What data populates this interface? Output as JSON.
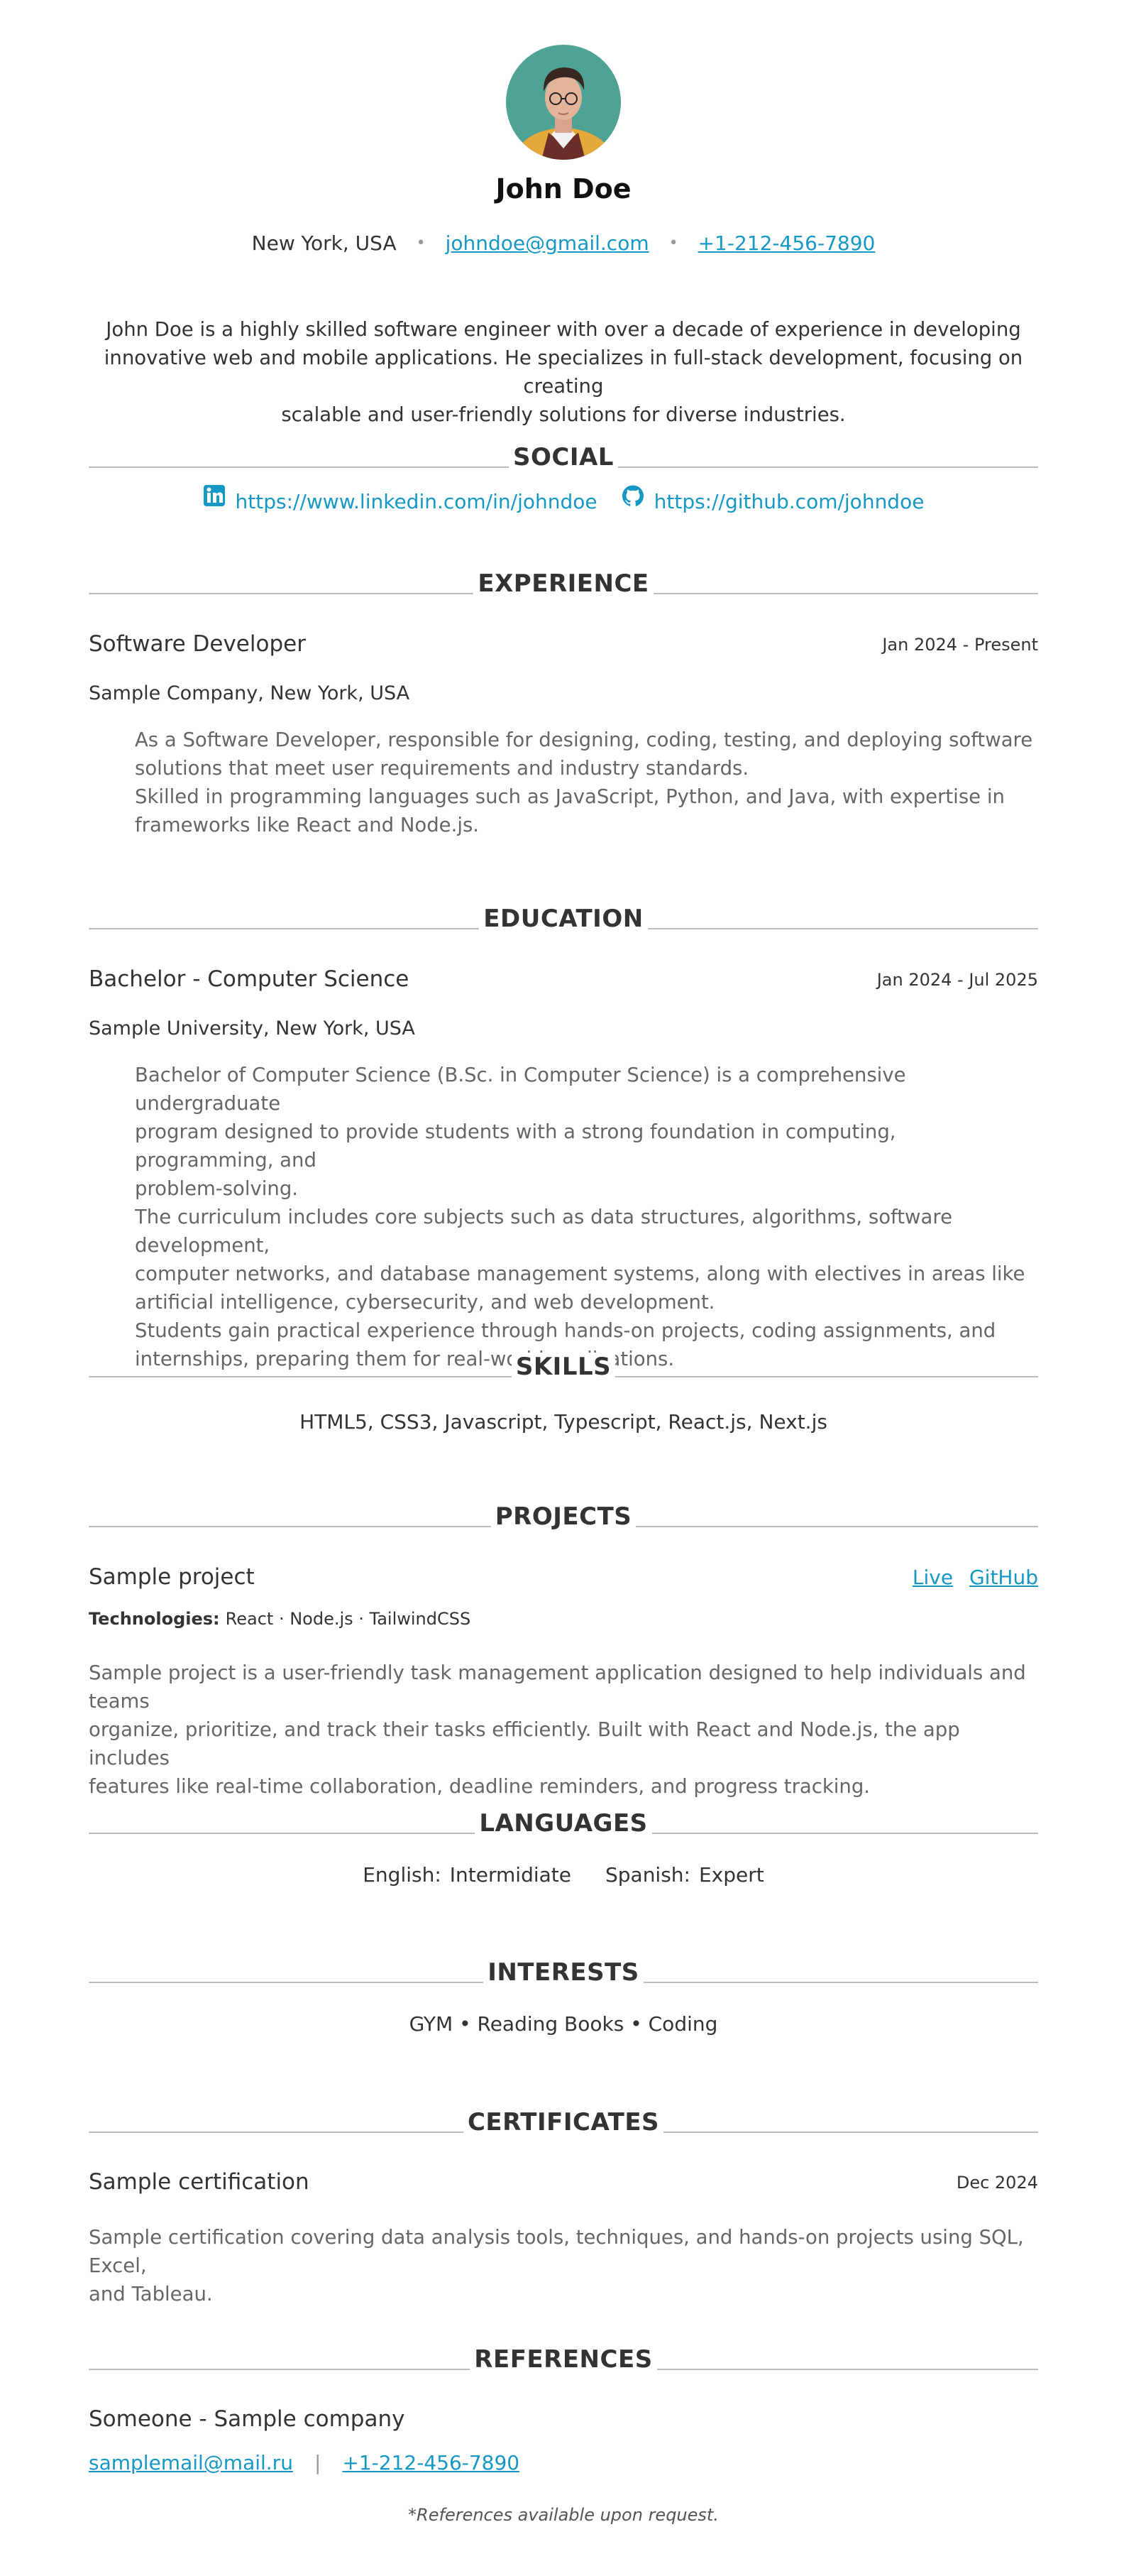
{
  "profile": {
    "name": "John Doe",
    "location": "New York, USA",
    "email": "johndoe@gmail.com",
    "phone": "+1-212-456-7890",
    "summary_lines": [
      "John Doe is a highly skilled software engineer with over a decade of experience in developing",
      "innovative web and mobile applications. He specializes in full-stack development, focusing on creating",
      "scalable and user-friendly solutions for diverse industries."
    ]
  },
  "sections": {
    "social": "SOCIAL",
    "experience": "EXPERIENCE",
    "education": "EDUCATION",
    "skills": "SKILLS",
    "projects": "PROJECTS",
    "languages": "LANGUAGES",
    "interests": "INTERESTS",
    "certificates": "CERTIFICATES",
    "references": "REFERENCES"
  },
  "social": {
    "linkedin": "https://www.linkedin.com/in/johndoe",
    "github": "https://github.com/johndoe"
  },
  "experience": {
    "title": "Software Developer",
    "date": "Jan 2024 - Present",
    "company": "Sample Company, New York, USA",
    "lines": [
      "As a Software Developer, responsible for designing, coding, testing, and deploying software",
      "solutions that meet user requirements and industry standards.",
      "Skilled in programming languages such as JavaScript, Python, and Java, with expertise in",
      "frameworks like React and Node.js."
    ]
  },
  "education": {
    "title": "Bachelor - Computer Science",
    "date": "Jan 2024 - Jul 2025",
    "school": "Sample University, New York, USA",
    "lines": [
      "Bachelor of Computer Science (B.Sc. in Computer Science) is a comprehensive undergraduate",
      "program designed to provide students with a strong foundation in computing, programming, and",
      "problem-solving.",
      "The curriculum includes core subjects such as data structures, algorithms, software development,",
      "computer networks, and database management systems, along with electives in areas like",
      "artificial intelligence, cybersecurity, and web development.",
      "Students gain practical experience through hands-on projects, coding assignments, and",
      "internships, preparing them for real-world applications."
    ]
  },
  "skills": "HTML5, CSS3, Javascript, Typescript, React.js, Next.js",
  "project": {
    "title": "Sample project",
    "live_label": "Live",
    "github_label": "GitHub",
    "tech_label": "Technologies:",
    "tech": "React · Node.js · TailwindCSS",
    "lines": [
      "Sample project is a user-friendly task management application designed to help individuals and teams",
      "organize, prioritize, and track their tasks efficiently. Built with React and Node.js, the app includes",
      "features like real-time collaboration, deadline reminders, and progress tracking."
    ]
  },
  "languages": [
    {
      "name": "English:",
      "level": "Intermidiate"
    },
    {
      "name": "Spanish:",
      "level": "Expert"
    }
  ],
  "interests": "GYM • Reading Books • Coding",
  "certificate": {
    "title": "Sample certification",
    "date": "Dec 2024",
    "lines": [
      "Sample certification covering data analysis tools, techniques, and hands-on projects using SQL, Excel,",
      "and Tableau."
    ]
  },
  "reference": {
    "title": "Someone - Sample company",
    "email": "samplemail@mail.ru",
    "separator": "|",
    "phone": "+1-212-456-7890",
    "note": "*References available upon request."
  }
}
